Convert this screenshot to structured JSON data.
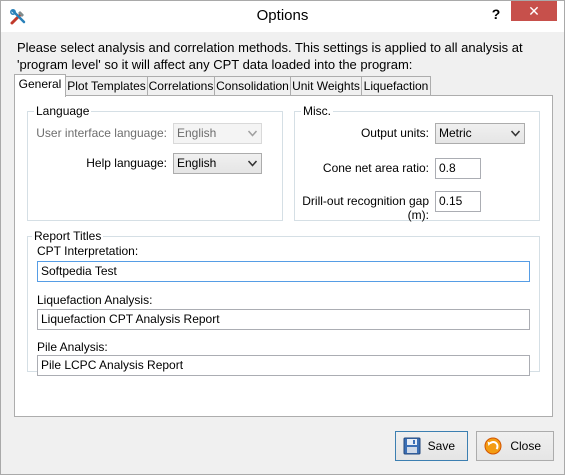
{
  "window": {
    "title": "Options",
    "help_glyph": "?",
    "close_glyph": "✕"
  },
  "intro_text": "Please select analysis and correlation methods. This settings is applied to all analysis at 'program level' so it will affect any CPT data loaded into the program:",
  "tabs": [
    {
      "label": "General",
      "active": true
    },
    {
      "label": "Plot Templates"
    },
    {
      "label": "Correlations"
    },
    {
      "label": "Consolidation"
    },
    {
      "label": "Unit Weights"
    },
    {
      "label": "Liquefaction"
    }
  ],
  "language": {
    "title": "Language",
    "ui_label": "User interface language:",
    "ui_value": "English",
    "help_label": "Help language:",
    "help_value": "English"
  },
  "misc": {
    "title": "Misc.",
    "output_units_label": "Output units:",
    "output_units_value": "Metric",
    "cone_label": "Cone net area ratio:",
    "cone_value": "0.8",
    "drill_label": "Drill-out recognition gap (m):",
    "drill_value": "0.15"
  },
  "report_titles": {
    "title": "Report Titles",
    "cpt_label": "CPT Interpretation:",
    "cpt_value": "Softpedia Test",
    "liq_label": "Liquefaction Analysis:",
    "liq_value": "Liquefaction CPT Analysis Report",
    "pile_label": "Pile Analysis:",
    "pile_value": "Pile LCPC Analysis Report"
  },
  "buttons": {
    "save_label": "Save",
    "close_label": "Close"
  },
  "colors": {
    "focus_border": "#569de5",
    "close_button": "#c7504b"
  }
}
